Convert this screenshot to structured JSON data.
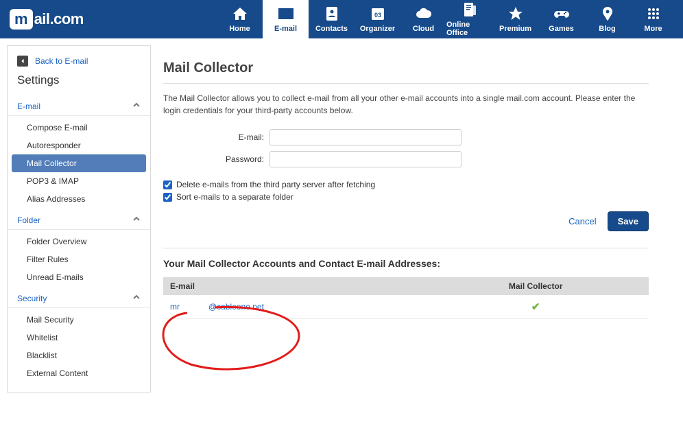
{
  "logo": {
    "box": "m",
    "rest": "ail.com"
  },
  "topnav": [
    {
      "label": "Home",
      "icon": "home"
    },
    {
      "label": "E-mail",
      "icon": "email",
      "active": true
    },
    {
      "label": "Contacts",
      "icon": "contacts"
    },
    {
      "label": "Organizer",
      "icon": "organizer"
    },
    {
      "label": "Cloud",
      "icon": "cloud"
    },
    {
      "label": "Online Office",
      "icon": "office"
    },
    {
      "label": "Premium",
      "icon": "star"
    },
    {
      "label": "Games",
      "icon": "games"
    },
    {
      "label": "Blog",
      "icon": "blog"
    },
    {
      "label": "More",
      "icon": "grid"
    }
  ],
  "sidebar": {
    "back": "Back to E-mail",
    "title": "Settings",
    "sections": [
      {
        "header": "E-mail",
        "items": [
          "Compose E-mail",
          "Autoresponder",
          "Mail Collector",
          "POP3 & IMAP",
          "Alias Addresses"
        ],
        "activeIndex": 2
      },
      {
        "header": "Folder",
        "items": [
          "Folder Overview",
          "Filter Rules",
          "Unread E-mails"
        ]
      },
      {
        "header": "Security",
        "items": [
          "Mail Security",
          "Whitelist",
          "Blacklist",
          "External Content"
        ]
      }
    ]
  },
  "main": {
    "title": "Mail Collector",
    "desc": "The Mail Collector allows you to collect e-mail from all your other e-mail accounts into a single mail.com account. Please enter the login credentials for your third-party accounts below.",
    "emailLabel": "E-mail:",
    "passwordLabel": "Password:",
    "emailValue": "",
    "passwordValue": "",
    "check1": "Delete e-mails from the third party server after fetching",
    "check2": "Sort e-mails to a separate folder",
    "cancel": "Cancel",
    "save": "Save",
    "accountsTitle": "Your Mail Collector Accounts and Contact E-mail Addresses:",
    "col1": "E-mail",
    "col2": "Mail Collector",
    "rows": [
      {
        "prefix": "mr",
        "suffix": "@cableone.net",
        "ok": true
      }
    ]
  }
}
